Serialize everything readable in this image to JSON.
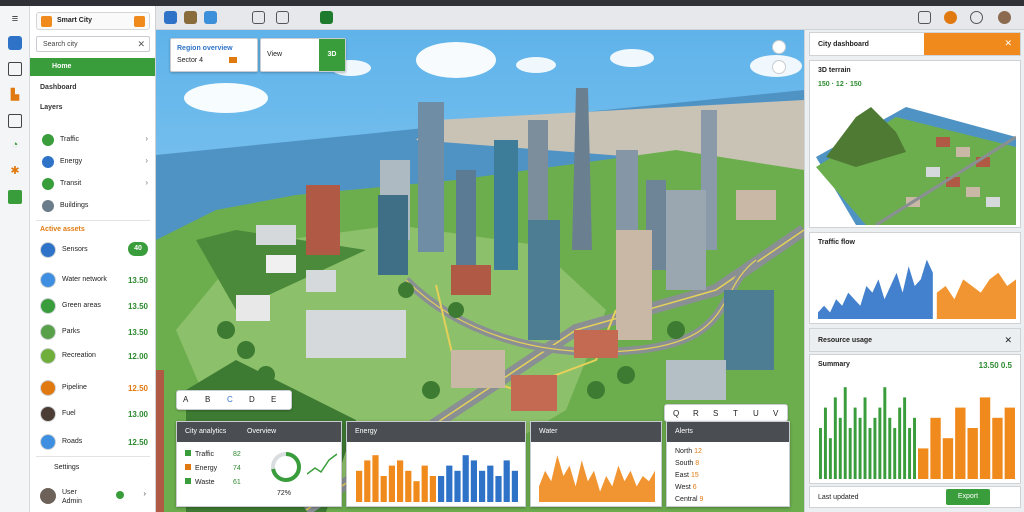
{
  "colors": {
    "accent_green": "#3a9d3c",
    "accent_orange": "#f08a1c",
    "chart_blue": "#2f73c9",
    "dark_header": "#4a4d52"
  },
  "rail": {
    "icons": [
      "menu-icon",
      "dashboard-icon",
      "layers-icon",
      "analytics-icon",
      "building-icon",
      "map-icon",
      "grid-icon"
    ]
  },
  "sidebar": {
    "app_title": "Smart City",
    "search": "Search city",
    "active_item": "Home",
    "sections": [
      {
        "label": "Dashboard"
      },
      {
        "label": "Layers"
      }
    ],
    "items": [
      {
        "label": "Traffic",
        "icon": "traffic-icon"
      },
      {
        "label": "Energy",
        "icon": "energy-icon"
      },
      {
        "label": "Transit",
        "icon": "transit-icon"
      },
      {
        "label": "Buildings",
        "icon": "buildings-icon"
      }
    ],
    "assets_title": "Active assets",
    "assets": [
      {
        "label": "Sensors",
        "value": "40",
        "pill": true
      },
      {
        "label": "Water network",
        "value": "13.50"
      },
      {
        "label": "Green areas",
        "value": "13.50"
      },
      {
        "label": "Parks",
        "value": "13.50"
      },
      {
        "label": "Recreation",
        "value": "12.00"
      },
      {
        "label": "Pipeline",
        "value": "12.50"
      },
      {
        "label": "Fuel",
        "value": "13.00"
      },
      {
        "label": "Roads",
        "value": "12.50"
      }
    ],
    "footer_item": "Settings",
    "user": {
      "line1": "User",
      "line2": "Admin"
    }
  },
  "map": {
    "overlay_card": {
      "line1": "Region overview",
      "line2": "Sector 4"
    },
    "overlay_card2": {
      "label": "View",
      "badge": "3D"
    },
    "bottom_toolbar": [
      "A",
      "B",
      "C",
      "D",
      "E"
    ],
    "mini_toolbar": [
      "Q",
      "R",
      "S",
      "T",
      "U",
      "V"
    ]
  },
  "bottom_panels": {
    "panel1": {
      "title": "City analytics",
      "tab": "Overview",
      "rows": [
        {
          "label": "Traffic",
          "value": "82"
        },
        {
          "label": "Energy",
          "value": "74"
        },
        {
          "label": "Waste",
          "value": "61"
        }
      ],
      "gauge_value": 0.72,
      "gauge_label": "72%"
    },
    "panel2": {
      "title": "Energy"
    },
    "panel3": {
      "title": "Water"
    },
    "panel4": {
      "title": "Alerts",
      "rows": [
        {
          "label": "North",
          "value": "12"
        },
        {
          "label": "South",
          "value": "8"
        },
        {
          "label": "East",
          "value": "15"
        },
        {
          "label": "West",
          "value": "6"
        },
        {
          "label": "Central",
          "value": "9"
        }
      ]
    }
  },
  "right_panel": {
    "header_title": "City dashboard",
    "card1": {
      "title": "3D terrain",
      "stats": [
        "150",
        "12",
        "150"
      ]
    },
    "card2": {
      "title": "Traffic flow"
    },
    "card3": {
      "title": "Resource usage",
      "header": "Summary",
      "value": "13.50 0.5"
    },
    "footer": {
      "label": "Last updated",
      "button": "Export"
    }
  },
  "chart_data": [
    {
      "type": "bar",
      "title": "Energy",
      "series": [
        {
          "name": "orange",
          "values": [
            6,
            8,
            9,
            5,
            7,
            8,
            6,
            4,
            7,
            5
          ]
        },
        {
          "name": "blue",
          "values": [
            5,
            7,
            6,
            9,
            8,
            6,
            7,
            5,
            8,
            6
          ]
        }
      ]
    },
    {
      "type": "area",
      "title": "Water",
      "series": [
        {
          "name": "orange",
          "values": [
            3,
            6,
            4,
            9,
            5,
            7,
            3,
            8,
            4,
            6,
            2,
            5,
            3,
            7,
            4,
            6,
            3,
            5,
            4,
            6
          ]
        }
      ]
    },
    {
      "type": "area",
      "title": "Traffic flow",
      "series": [
        {
          "name": "blue",
          "values": [
            1,
            2,
            1,
            3,
            2,
            4,
            3,
            2,
            5,
            4,
            6,
            3,
            5,
            7,
            4,
            8,
            5,
            6,
            9,
            7
          ]
        },
        {
          "name": "orange",
          "values": [
            4,
            5,
            3,
            6,
            5,
            4,
            6,
            7,
            5,
            6
          ]
        }
      ]
    },
    {
      "type": "bar",
      "title": "Resource usage",
      "series": [
        {
          "name": "green",
          "values": [
            5,
            7,
            4,
            8,
            6,
            9,
            5,
            7,
            6,
            8,
            5,
            6,
            7,
            9,
            6,
            5,
            7,
            8,
            5,
            6
          ]
        },
        {
          "name": "orange",
          "values": [
            3,
            6,
            4,
            7,
            5,
            8,
            6,
            7
          ]
        }
      ]
    }
  ]
}
